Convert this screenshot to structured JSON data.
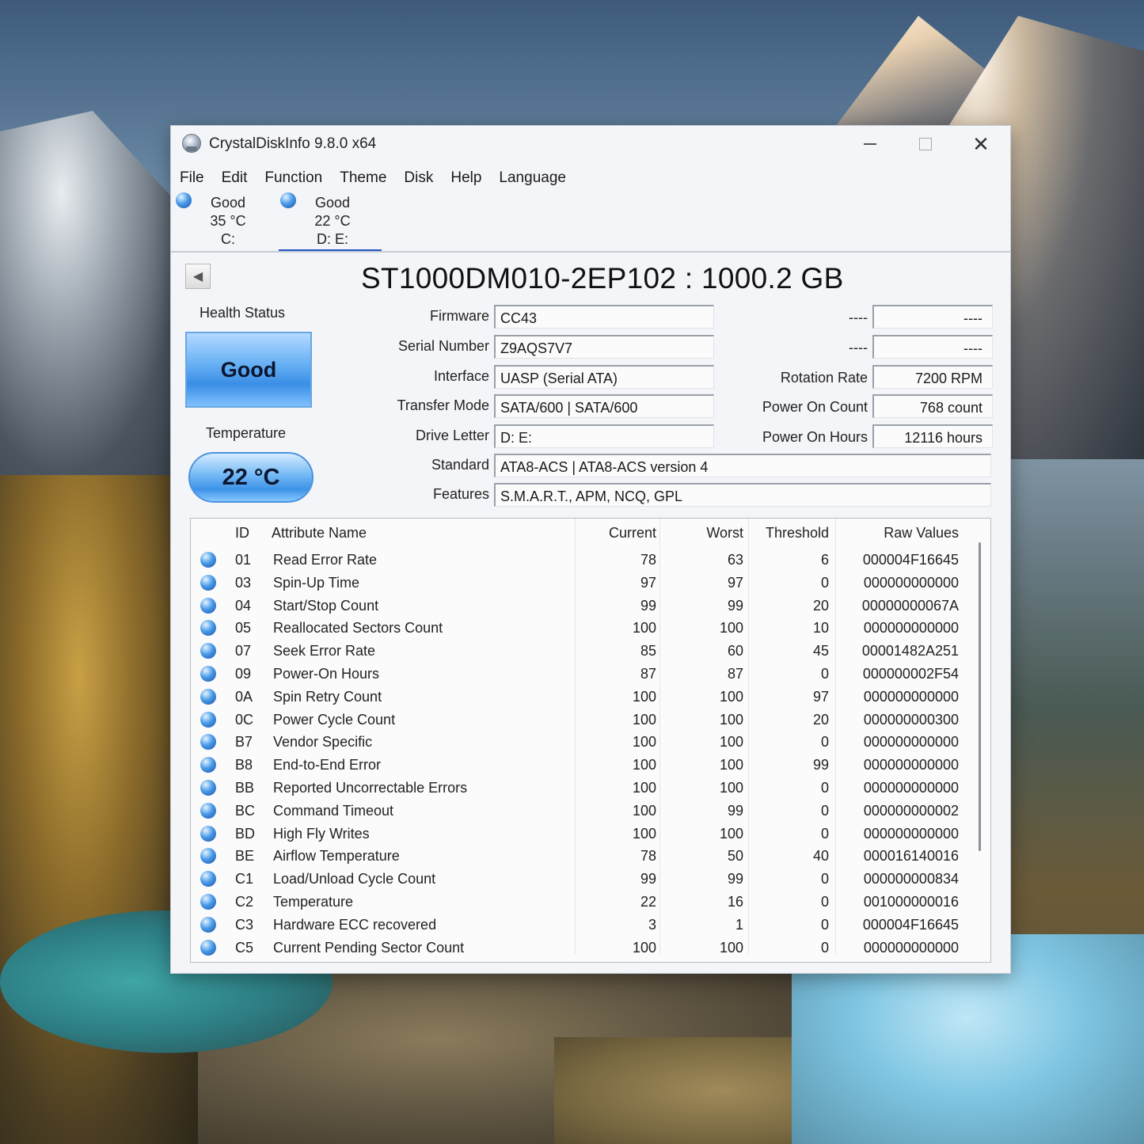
{
  "window": {
    "title": "CrystalDiskInfo 9.8.0 x64",
    "controls": {
      "minimize": "—",
      "maximize": "",
      "close": "✕"
    }
  },
  "menu": [
    "File",
    "Edit",
    "Function",
    "Theme",
    "Disk",
    "Help",
    "Language"
  ],
  "disk_tabs": [
    {
      "status": "Good",
      "temp": "35 °C",
      "letter": "C:"
    },
    {
      "status": "Good",
      "temp": "22 °C",
      "letter": "D: E:"
    }
  ],
  "drive": {
    "title": "ST1000DM010-2EP102 : 1000.2 GB",
    "health_label": "Health Status",
    "health_value": "Good",
    "temp_label": "Temperature",
    "temp_value": "22 °C",
    "left_fields": [
      {
        "label": "Firmware",
        "value": "CC43"
      },
      {
        "label": "Serial Number",
        "value": "Z9AQS7V7"
      },
      {
        "label": "Interface",
        "value": "UASP (Serial ATA)"
      },
      {
        "label": "Transfer Mode",
        "value": "SATA/600 | SATA/600"
      },
      {
        "label": "Drive Letter",
        "value": "D: E:"
      },
      {
        "label": "Standard",
        "value": "ATA8-ACS | ATA8-ACS version 4"
      },
      {
        "label": "Features",
        "value": "S.M.A.R.T., APM, NCQ, GPL"
      }
    ],
    "right_fields": [
      {
        "label": "----",
        "value": "----"
      },
      {
        "label": "----",
        "value": "----"
      },
      {
        "label": "Rotation Rate",
        "value": "7200 RPM"
      },
      {
        "label": "Power On Count",
        "value": "768 count"
      },
      {
        "label": "Power On Hours",
        "value": "12116 hours"
      }
    ]
  },
  "smart": {
    "headers": {
      "id": "ID",
      "name": "Attribute Name",
      "current": "Current",
      "worst": "Worst",
      "threshold": "Threshold",
      "raw": "Raw Values"
    },
    "rows": [
      {
        "id": "01",
        "name": "Read Error Rate",
        "current": "78",
        "worst": "63",
        "threshold": "6",
        "raw": "000004F16645"
      },
      {
        "id": "03",
        "name": "Spin-Up Time",
        "current": "97",
        "worst": "97",
        "threshold": "0",
        "raw": "000000000000"
      },
      {
        "id": "04",
        "name": "Start/Stop Count",
        "current": "99",
        "worst": "99",
        "threshold": "20",
        "raw": "00000000067A"
      },
      {
        "id": "05",
        "name": "Reallocated Sectors Count",
        "current": "100",
        "worst": "100",
        "threshold": "10",
        "raw": "000000000000"
      },
      {
        "id": "07",
        "name": "Seek Error Rate",
        "current": "85",
        "worst": "60",
        "threshold": "45",
        "raw": "00001482A251"
      },
      {
        "id": "09",
        "name": "Power-On Hours",
        "current": "87",
        "worst": "87",
        "threshold": "0",
        "raw": "000000002F54"
      },
      {
        "id": "0A",
        "name": "Spin Retry Count",
        "current": "100",
        "worst": "100",
        "threshold": "97",
        "raw": "000000000000"
      },
      {
        "id": "0C",
        "name": "Power Cycle Count",
        "current": "100",
        "worst": "100",
        "threshold": "20",
        "raw": "000000000300"
      },
      {
        "id": "B7",
        "name": "Vendor Specific",
        "current": "100",
        "worst": "100",
        "threshold": "0",
        "raw": "000000000000"
      },
      {
        "id": "B8",
        "name": "End-to-End Error",
        "current": "100",
        "worst": "100",
        "threshold": "99",
        "raw": "000000000000"
      },
      {
        "id": "BB",
        "name": "Reported Uncorrectable Errors",
        "current": "100",
        "worst": "100",
        "threshold": "0",
        "raw": "000000000000"
      },
      {
        "id": "BC",
        "name": "Command Timeout",
        "current": "100",
        "worst": "99",
        "threshold": "0",
        "raw": "000000000002"
      },
      {
        "id": "BD",
        "name": "High Fly Writes",
        "current": "100",
        "worst": "100",
        "threshold": "0",
        "raw": "000000000000"
      },
      {
        "id": "BE",
        "name": "Airflow Temperature",
        "current": "78",
        "worst": "50",
        "threshold": "40",
        "raw": "000016140016"
      },
      {
        "id": "C1",
        "name": "Load/Unload Cycle Count",
        "current": "99",
        "worst": "99",
        "threshold": "0",
        "raw": "000000000834"
      },
      {
        "id": "C2",
        "name": "Temperature",
        "current": "22",
        "worst": "16",
        "threshold": "0",
        "raw": "001000000016"
      },
      {
        "id": "C3",
        "name": "Hardware ECC recovered",
        "current": "3",
        "worst": "1",
        "threshold": "0",
        "raw": "000004F16645"
      },
      {
        "id": "C5",
        "name": "Current Pending Sector Count",
        "current": "100",
        "worst": "100",
        "threshold": "0",
        "raw": "000000000000"
      }
    ]
  }
}
